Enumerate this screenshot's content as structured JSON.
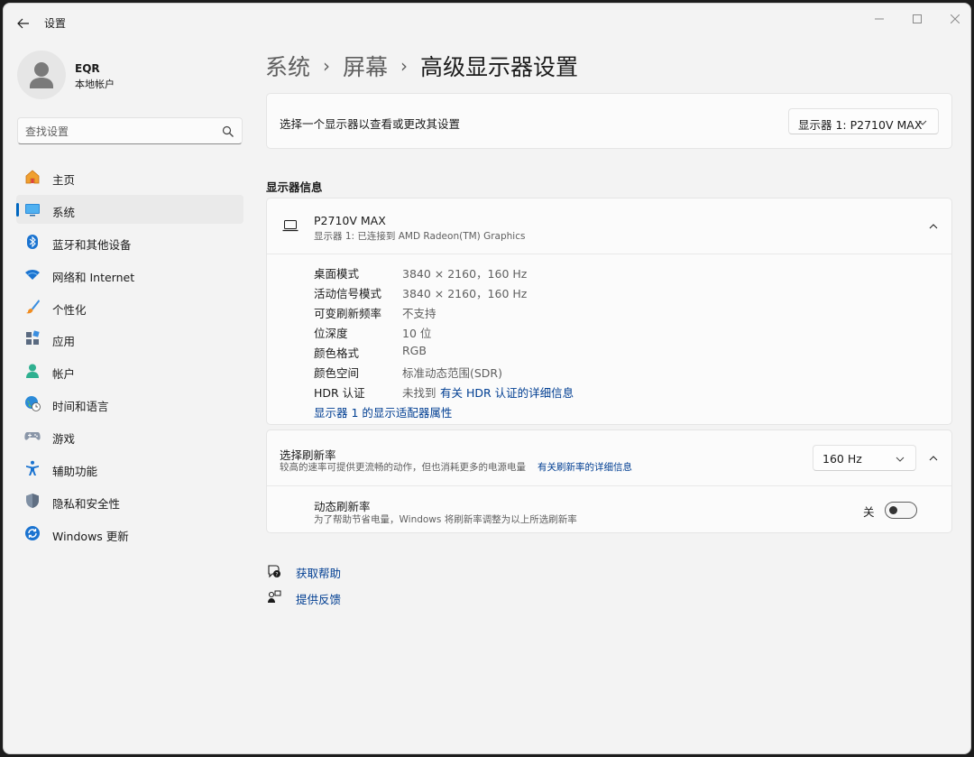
{
  "window": {
    "title": "设置"
  },
  "profile": {
    "name": "EQR",
    "account_type": "本地帐户"
  },
  "search": {
    "placeholder": "查找设置"
  },
  "sidebar": {
    "items": [
      {
        "label": "主页",
        "icon": "home-icon",
        "active": false
      },
      {
        "label": "系统",
        "icon": "system-icon",
        "active": true
      },
      {
        "label": "蓝牙和其他设备",
        "icon": "bluetooth-icon",
        "active": false
      },
      {
        "label": "网络和 Internet",
        "icon": "wifi-icon",
        "active": false
      },
      {
        "label": "个性化",
        "icon": "brush-icon",
        "active": false
      },
      {
        "label": "应用",
        "icon": "apps-icon",
        "active": false
      },
      {
        "label": "帐户",
        "icon": "account-icon",
        "active": false
      },
      {
        "label": "时间和语言",
        "icon": "globe-clock-icon",
        "active": false
      },
      {
        "label": "游戏",
        "icon": "gamepad-icon",
        "active": false
      },
      {
        "label": "辅助功能",
        "icon": "accessibility-icon",
        "active": false
      },
      {
        "label": "隐私和安全性",
        "icon": "shield-icon",
        "active": false
      },
      {
        "label": "Windows 更新",
        "icon": "update-icon",
        "active": false
      }
    ]
  },
  "breadcrumb": {
    "parts": [
      "系统",
      "屏幕"
    ],
    "current": "高级显示器设置"
  },
  "monitor_select": {
    "label": "选择一个显示器以查看或更改其设置",
    "value": "显示器 1: P2710V MAX"
  },
  "display_info": {
    "section_title": "显示器信息",
    "monitor_name": "P2710V MAX",
    "monitor_subtitle": "显示器 1: 已连接到 AMD Radeon(TM) Graphics",
    "specs": [
      {
        "key": "桌面模式",
        "value": "3840 × 2160，160 Hz"
      },
      {
        "key": "活动信号模式",
        "value": "3840 × 2160，160 Hz"
      },
      {
        "key": "可变刷新频率",
        "value": "不支持"
      },
      {
        "key": "位深度",
        "value": "10 位"
      },
      {
        "key": "颜色格式",
        "value": "RGB"
      },
      {
        "key": "颜色空间",
        "value": "标准动态范围(SDR)"
      },
      {
        "key": "HDR 认证",
        "value": "未找到"
      }
    ],
    "hdr_link": "有关 HDR 认证的详细信息",
    "adapter_link": "显示器 1 的显示适配器属性"
  },
  "refresh": {
    "title": "选择刷新率",
    "description": "较高的速率可提供更流畅的动作，但也消耗更多的电源电量",
    "description_link": "有关刷新率的详细信息",
    "value": "160 Hz",
    "dynamic_title": "动态刷新率",
    "dynamic_description": "为了帮助节省电量，Windows 将刷新率调整为以上所选刷新率",
    "dynamic_state_label": "关",
    "dynamic_enabled": false
  },
  "help": {
    "get_help": "获取帮助",
    "feedback": "提供反馈"
  },
  "colors": {
    "accent": "#0067c0",
    "link": "#003e92",
    "background": "#f3f3f3",
    "card": "#fbfbfb"
  }
}
